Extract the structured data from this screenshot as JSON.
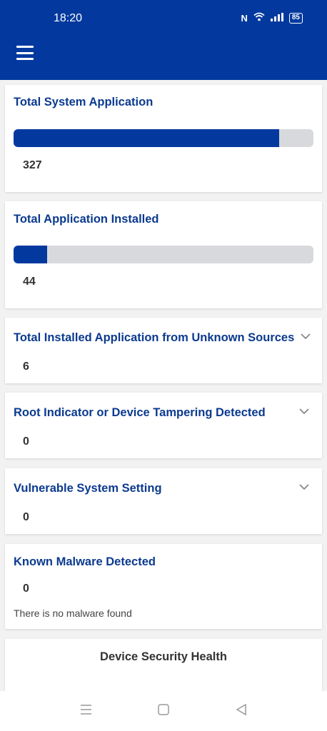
{
  "status_bar": {
    "time": "18:20",
    "nfc": "N",
    "battery": "85"
  },
  "cards": {
    "system_apps": {
      "title": "Total System Application",
      "value": "327",
      "progress": 0.885
    },
    "installed_apps": {
      "title": "Total Application Installed",
      "value": "44",
      "progress": 0.112
    },
    "unknown_sources": {
      "title": "Total Installed Application from Unknown Sources",
      "value": "6"
    },
    "root_indicator": {
      "title": "Root Indicator or Device Tampering Detected",
      "value": "0"
    },
    "vulnerable_setting": {
      "title": "Vulnerable System Setting",
      "value": "0"
    },
    "malware": {
      "title": "Known Malware Detected",
      "value": "0",
      "note": "There is no malware found"
    },
    "health": {
      "title": "Device Security Health"
    }
  },
  "colors": {
    "primary": "#03399e",
    "track": "#d7d9dc",
    "title": "#0b3a8f"
  },
  "icons": [
    "menu-icon",
    "nfc-icon",
    "wifi-icon",
    "signal-icon",
    "battery-icon",
    "chevron-down-icon",
    "recents-icon",
    "home-icon",
    "back-icon"
  ]
}
